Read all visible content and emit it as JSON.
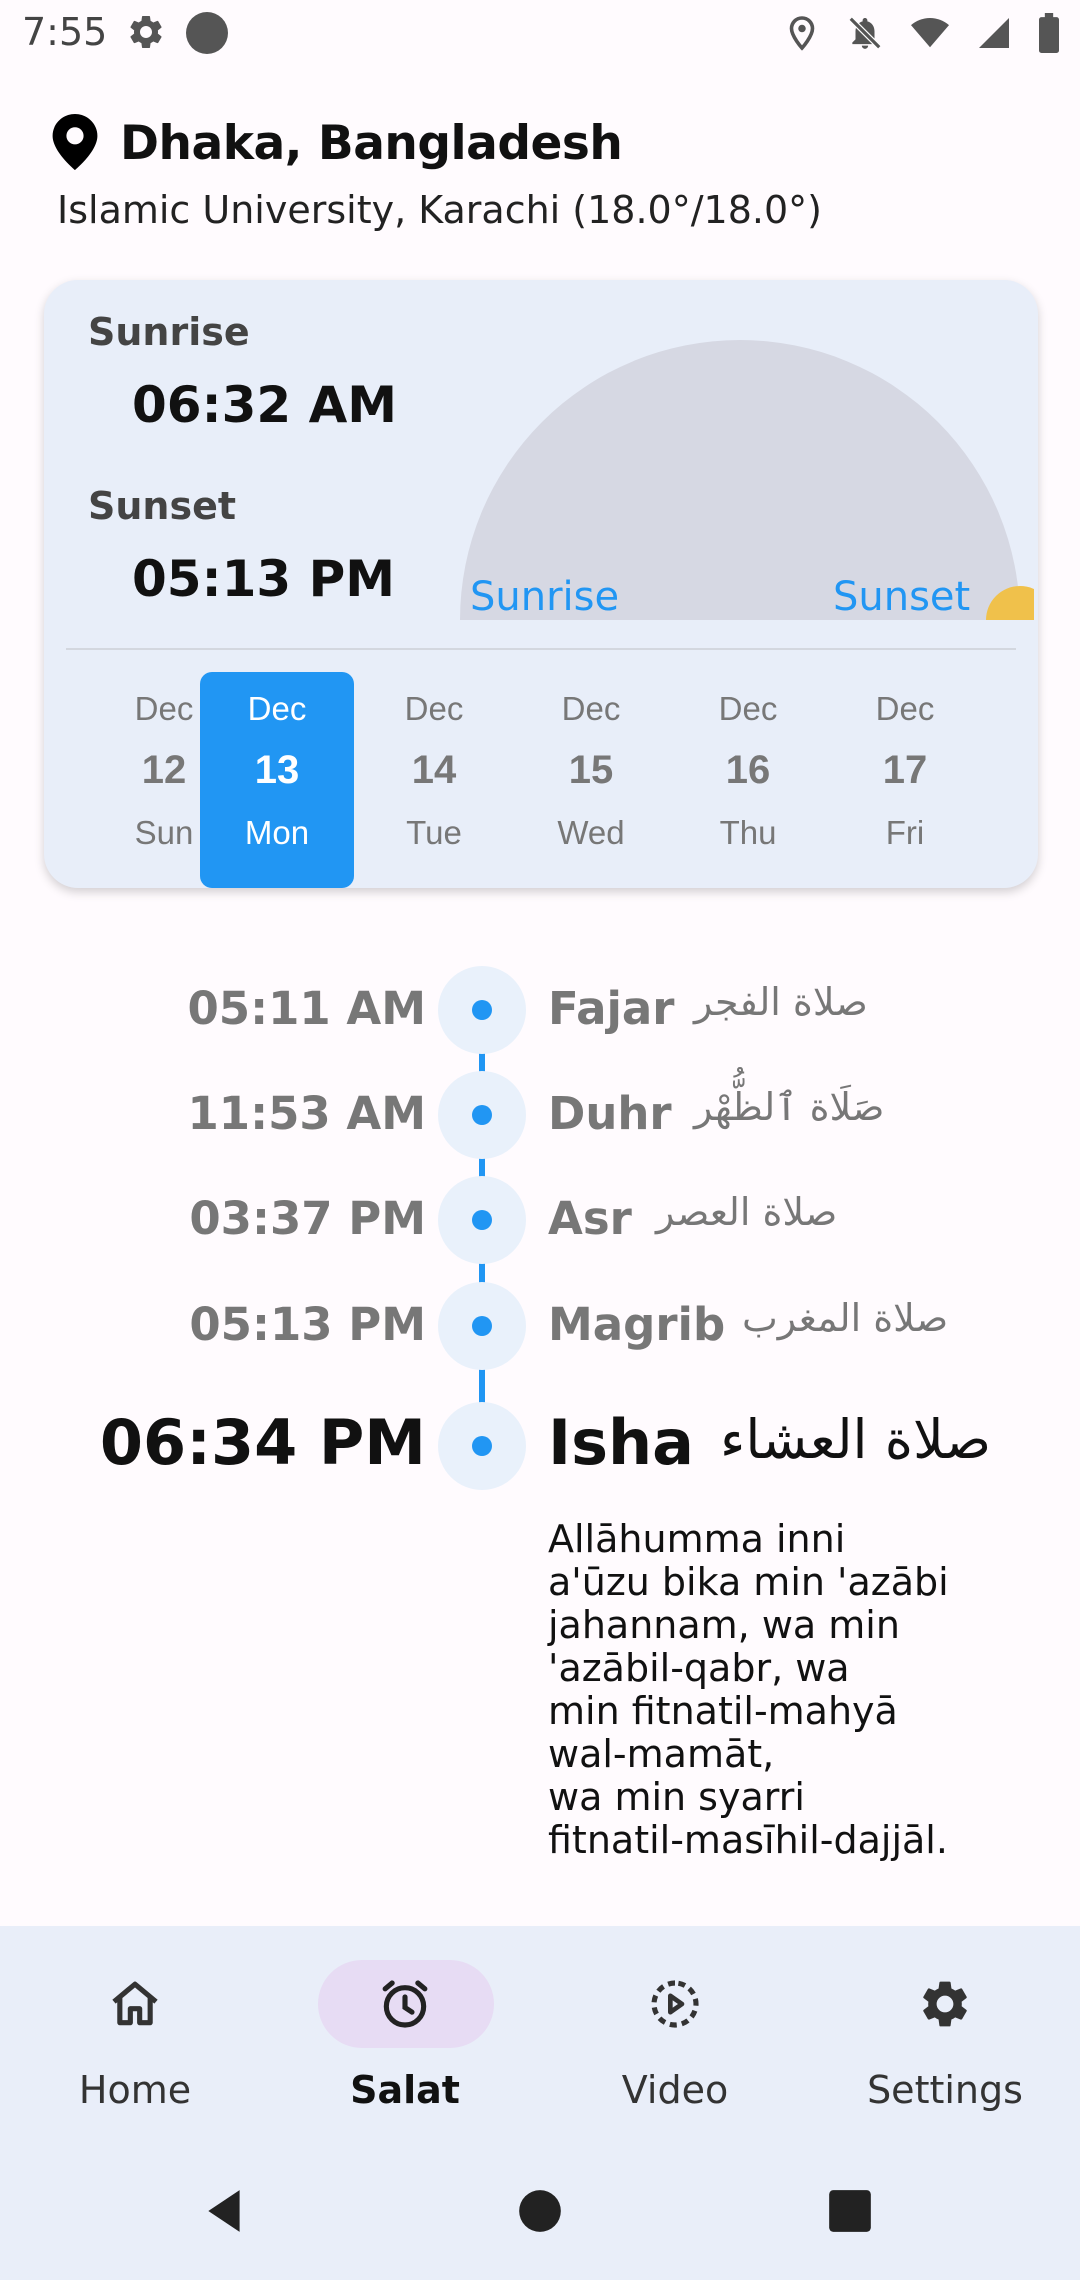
{
  "status_bar": {
    "time": "7:55",
    "icons": [
      "settings-icon",
      "circle-indicator-icon",
      "location-icon",
      "notifications-off-icon",
      "wifi-icon",
      "cellular-signal-icon",
      "battery-icon"
    ]
  },
  "location": {
    "city": "Dhaka, Bangladesh",
    "method": "Islamic University, Karachi (18.0°/18.0°)"
  },
  "sun_card": {
    "sunrise_label": "Sunrise",
    "sunrise_time": "06:32 AM",
    "sunset_label": "Sunset",
    "sunset_time": "05:13 PM",
    "arc_sunrise_label": "Sunrise",
    "arc_sunset_label": "Sunset",
    "sun_progress": 1.0,
    "colors": {
      "arc": "#d6d8e3",
      "arc_labels": "#2196f3",
      "sun": "#f0c14b"
    }
  },
  "dates": [
    {
      "month": "Dec",
      "day": "12",
      "weekday": "Sun",
      "selected": false
    },
    {
      "month": "Dec",
      "day": "13",
      "weekday": "Mon",
      "selected": true
    },
    {
      "month": "Dec",
      "day": "14",
      "weekday": "Tue",
      "selected": false
    },
    {
      "month": "Dec",
      "day": "15",
      "weekday": "Wed",
      "selected": false
    },
    {
      "month": "Dec",
      "day": "16",
      "weekday": "Thu",
      "selected": false
    },
    {
      "month": "Dec",
      "day": "17",
      "weekday": "Fri",
      "selected": false
    }
  ],
  "prayers": [
    {
      "time": "05:11 AM",
      "name": "Fajar",
      "arabic": "صلاة الفجر",
      "active": false
    },
    {
      "time": "11:53 AM",
      "name": "Duhr",
      "arabic": "صَلَاة ٱلظُّهْر",
      "active": false
    },
    {
      "time": "03:37 PM",
      "name": "Asr",
      "arabic": "صلاة العصر",
      "active": false
    },
    {
      "time": "05:13 PM",
      "name": "Magrib",
      "arabic": "صلاة المغرب",
      "active": false
    },
    {
      "time": "06:34 PM",
      "name": "Isha",
      "arabic": "صلاة العشاء",
      "active": true
    }
  ],
  "dua": " Allāhumma inni\na'ūzu bika min 'azābi\njahannam, wa min\n'azābil-qabr, wa\nmin fitnatil-mahyā\nwal-mamāt,\nwa min syarri\nfitnatil-masīhil-dajjāl.",
  "bottom_nav": [
    {
      "label": "Home",
      "icon": "home-icon",
      "selected": false
    },
    {
      "label": "Salat",
      "icon": "alarm-clock-icon",
      "selected": true
    },
    {
      "label": "Video",
      "icon": "play-circle-icon",
      "selected": false
    },
    {
      "label": "Settings",
      "icon": "gear-icon",
      "selected": false
    }
  ],
  "colors": {
    "accent": "#2196f3",
    "nav_selected_pill": "#e7dcf4",
    "card_bg": "#e8eef9"
  }
}
